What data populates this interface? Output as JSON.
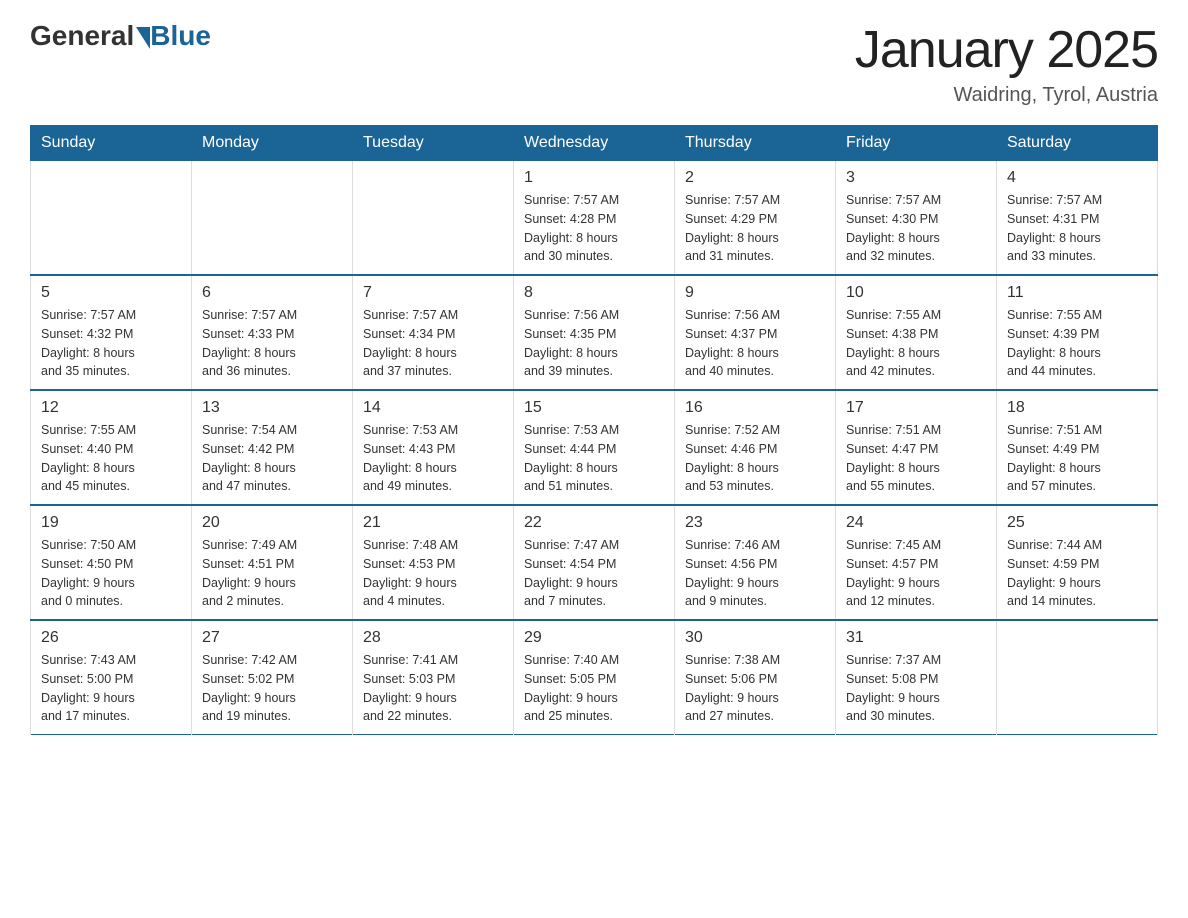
{
  "header": {
    "logo_general": "General",
    "logo_blue": "Blue",
    "calendar_title": "January 2025",
    "calendar_subtitle": "Waidring, Tyrol, Austria"
  },
  "days_of_week": [
    "Sunday",
    "Monday",
    "Tuesday",
    "Wednesday",
    "Thursday",
    "Friday",
    "Saturday"
  ],
  "weeks": [
    [
      {
        "day": "",
        "info": ""
      },
      {
        "day": "",
        "info": ""
      },
      {
        "day": "",
        "info": ""
      },
      {
        "day": "1",
        "info": "Sunrise: 7:57 AM\nSunset: 4:28 PM\nDaylight: 8 hours\nand 30 minutes."
      },
      {
        "day": "2",
        "info": "Sunrise: 7:57 AM\nSunset: 4:29 PM\nDaylight: 8 hours\nand 31 minutes."
      },
      {
        "day": "3",
        "info": "Sunrise: 7:57 AM\nSunset: 4:30 PM\nDaylight: 8 hours\nand 32 minutes."
      },
      {
        "day": "4",
        "info": "Sunrise: 7:57 AM\nSunset: 4:31 PM\nDaylight: 8 hours\nand 33 minutes."
      }
    ],
    [
      {
        "day": "5",
        "info": "Sunrise: 7:57 AM\nSunset: 4:32 PM\nDaylight: 8 hours\nand 35 minutes."
      },
      {
        "day": "6",
        "info": "Sunrise: 7:57 AM\nSunset: 4:33 PM\nDaylight: 8 hours\nand 36 minutes."
      },
      {
        "day": "7",
        "info": "Sunrise: 7:57 AM\nSunset: 4:34 PM\nDaylight: 8 hours\nand 37 minutes."
      },
      {
        "day": "8",
        "info": "Sunrise: 7:56 AM\nSunset: 4:35 PM\nDaylight: 8 hours\nand 39 minutes."
      },
      {
        "day": "9",
        "info": "Sunrise: 7:56 AM\nSunset: 4:37 PM\nDaylight: 8 hours\nand 40 minutes."
      },
      {
        "day": "10",
        "info": "Sunrise: 7:55 AM\nSunset: 4:38 PM\nDaylight: 8 hours\nand 42 minutes."
      },
      {
        "day": "11",
        "info": "Sunrise: 7:55 AM\nSunset: 4:39 PM\nDaylight: 8 hours\nand 44 minutes."
      }
    ],
    [
      {
        "day": "12",
        "info": "Sunrise: 7:55 AM\nSunset: 4:40 PM\nDaylight: 8 hours\nand 45 minutes."
      },
      {
        "day": "13",
        "info": "Sunrise: 7:54 AM\nSunset: 4:42 PM\nDaylight: 8 hours\nand 47 minutes."
      },
      {
        "day": "14",
        "info": "Sunrise: 7:53 AM\nSunset: 4:43 PM\nDaylight: 8 hours\nand 49 minutes."
      },
      {
        "day": "15",
        "info": "Sunrise: 7:53 AM\nSunset: 4:44 PM\nDaylight: 8 hours\nand 51 minutes."
      },
      {
        "day": "16",
        "info": "Sunrise: 7:52 AM\nSunset: 4:46 PM\nDaylight: 8 hours\nand 53 minutes."
      },
      {
        "day": "17",
        "info": "Sunrise: 7:51 AM\nSunset: 4:47 PM\nDaylight: 8 hours\nand 55 minutes."
      },
      {
        "day": "18",
        "info": "Sunrise: 7:51 AM\nSunset: 4:49 PM\nDaylight: 8 hours\nand 57 minutes."
      }
    ],
    [
      {
        "day": "19",
        "info": "Sunrise: 7:50 AM\nSunset: 4:50 PM\nDaylight: 9 hours\nand 0 minutes."
      },
      {
        "day": "20",
        "info": "Sunrise: 7:49 AM\nSunset: 4:51 PM\nDaylight: 9 hours\nand 2 minutes."
      },
      {
        "day": "21",
        "info": "Sunrise: 7:48 AM\nSunset: 4:53 PM\nDaylight: 9 hours\nand 4 minutes."
      },
      {
        "day": "22",
        "info": "Sunrise: 7:47 AM\nSunset: 4:54 PM\nDaylight: 9 hours\nand 7 minutes."
      },
      {
        "day": "23",
        "info": "Sunrise: 7:46 AM\nSunset: 4:56 PM\nDaylight: 9 hours\nand 9 minutes."
      },
      {
        "day": "24",
        "info": "Sunrise: 7:45 AM\nSunset: 4:57 PM\nDaylight: 9 hours\nand 12 minutes."
      },
      {
        "day": "25",
        "info": "Sunrise: 7:44 AM\nSunset: 4:59 PM\nDaylight: 9 hours\nand 14 minutes."
      }
    ],
    [
      {
        "day": "26",
        "info": "Sunrise: 7:43 AM\nSunset: 5:00 PM\nDaylight: 9 hours\nand 17 minutes."
      },
      {
        "day": "27",
        "info": "Sunrise: 7:42 AM\nSunset: 5:02 PM\nDaylight: 9 hours\nand 19 minutes."
      },
      {
        "day": "28",
        "info": "Sunrise: 7:41 AM\nSunset: 5:03 PM\nDaylight: 9 hours\nand 22 minutes."
      },
      {
        "day": "29",
        "info": "Sunrise: 7:40 AM\nSunset: 5:05 PM\nDaylight: 9 hours\nand 25 minutes."
      },
      {
        "day": "30",
        "info": "Sunrise: 7:38 AM\nSunset: 5:06 PM\nDaylight: 9 hours\nand 27 minutes."
      },
      {
        "day": "31",
        "info": "Sunrise: 7:37 AM\nSunset: 5:08 PM\nDaylight: 9 hours\nand 30 minutes."
      },
      {
        "day": "",
        "info": ""
      }
    ]
  ]
}
